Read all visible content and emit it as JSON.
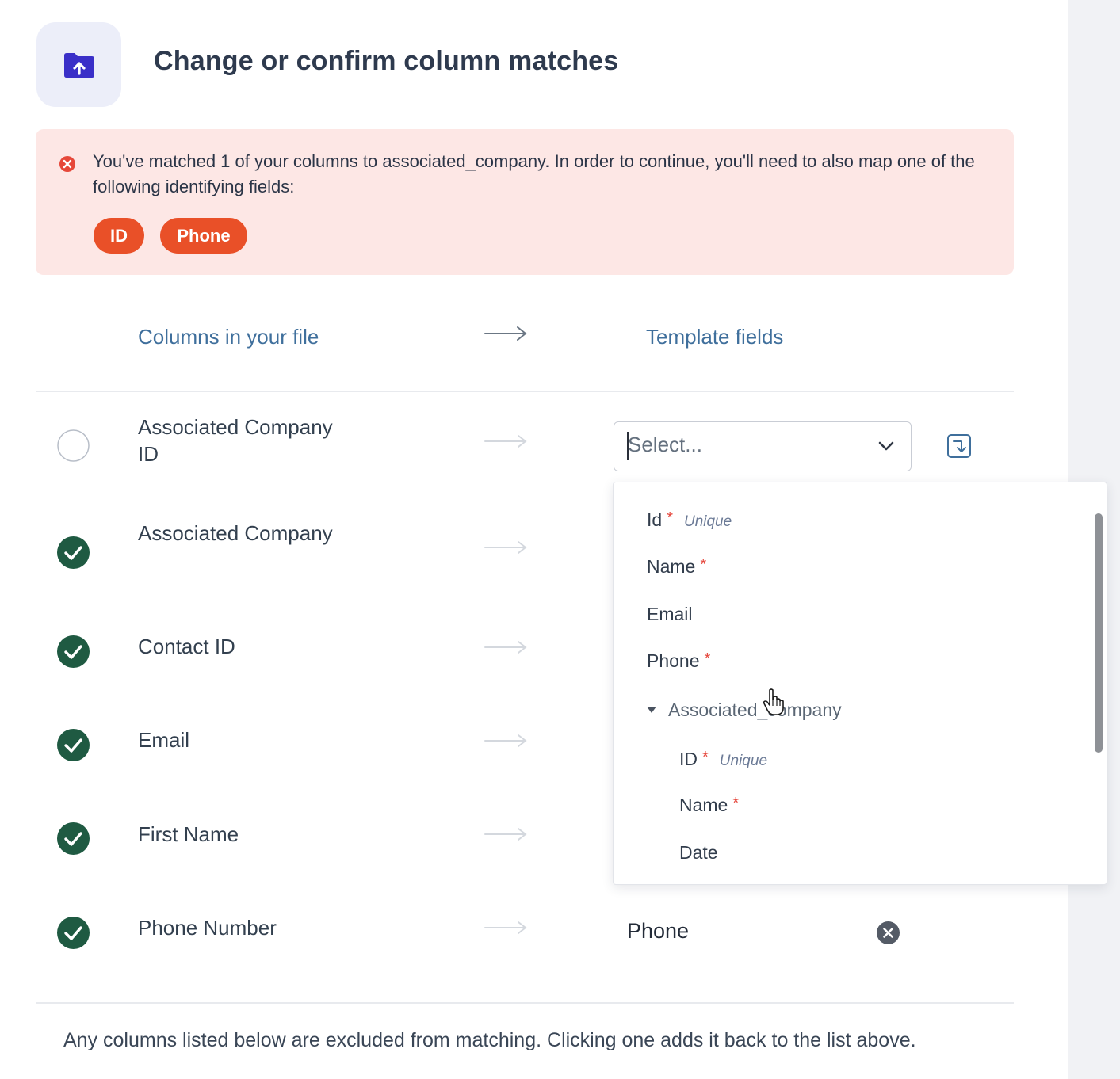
{
  "page": {
    "title": "Change or confirm column matches"
  },
  "header": {
    "icon": "folder-upload-icon",
    "icon_color": "#3a2fc8",
    "tile_color": "#eceef9"
  },
  "alert": {
    "icon": "error-x-icon",
    "message": "You've matched 1 of your columns to associated_company. In order to continue, you'll need to also map one of the following identifying fields:",
    "pills": [
      "ID",
      "Phone"
    ],
    "background": "#fde7e5",
    "pill_color": "#e95028"
  },
  "columns_header": {
    "left": "Columns in your file",
    "right": "Template fields"
  },
  "rows": [
    {
      "name": "Associated Company ID",
      "status": "unmatched"
    },
    {
      "name": "Associated Company",
      "status": "matched"
    },
    {
      "name": "Contact ID",
      "status": "matched"
    },
    {
      "name": "Email",
      "status": "matched"
    },
    {
      "name": "First Name",
      "status": "matched"
    },
    {
      "name": "Phone Number",
      "status": "matched",
      "template_value": "Phone"
    }
  ],
  "select": {
    "placeholder": "Select..."
  },
  "dropdown": {
    "options": [
      {
        "label": "Id",
        "required": "*",
        "badge": "Unique"
      },
      {
        "label": "Name",
        "required": "*"
      },
      {
        "label": "Email"
      },
      {
        "label": "Phone",
        "required": "*"
      }
    ],
    "group": {
      "label": "Associated_company",
      "options": [
        {
          "label": "ID",
          "required": "*",
          "badge": "Unique"
        },
        {
          "label": "Name",
          "required": "*"
        },
        {
          "label": "Date"
        }
      ]
    }
  },
  "footer": {
    "text": "Any columns listed below are excluded from matching. Clicking one adds it back to the list above."
  },
  "colors": {
    "matched_green": "#1f5a42",
    "accent_blue": "#3f6f9c",
    "required_red": "#e6493f"
  }
}
